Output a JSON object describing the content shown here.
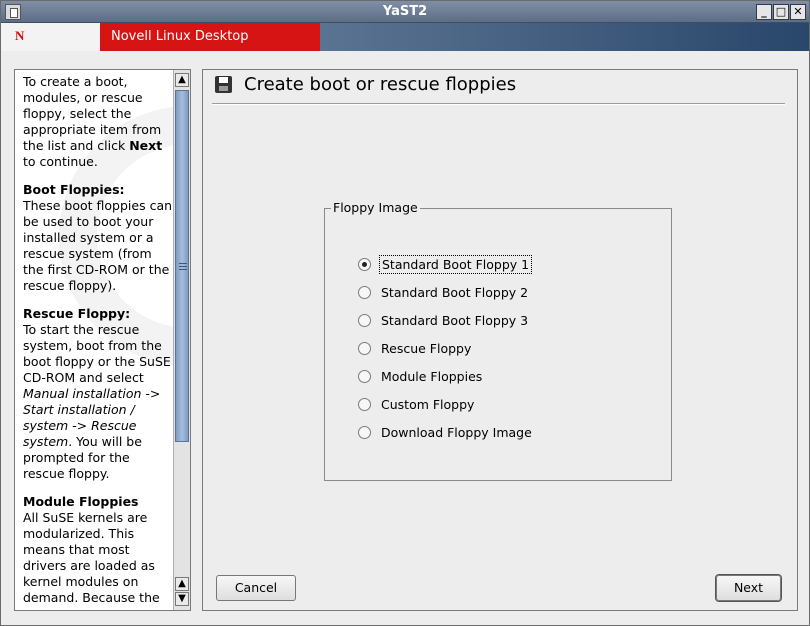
{
  "window": {
    "title": "YaST2",
    "minimize_label": "_",
    "maximize_label": "□",
    "close_label": "✕"
  },
  "banner": {
    "logo": "N",
    "product": "Novell Linux Desktop"
  },
  "help": {
    "intro_1": "To create a boot, modules, or rescue floppy, select the appropriate item from the list and click ",
    "intro_next": "Next",
    "intro_2": " to continue.",
    "boot_title": "Boot Floppies:",
    "boot_text": "These boot floppies can be used to boot your installed system or a rescue system (from the first CD-ROM or the rescue floppy).",
    "rescue_title": "Rescue Floppy:",
    "rescue_text_1": "To start the rescue system, boot from the boot floppy or the SuSE CD-ROM and select ",
    "rescue_italic": "Manual installation -> Start installation / system -> Rescue system",
    "rescue_text_2": ". You will be prompted for the rescue floppy.",
    "module_title": "Module Floppies",
    "module_text": "All SuSE kernels are modularized. This means that most drivers are loaded as kernel modules on demand. Because the space on",
    "scroll_up": "▲",
    "scroll_down": "▼"
  },
  "main": {
    "heading": "Create boot or rescue floppies",
    "group_label": "Floppy Image",
    "options": [
      {
        "label": "Standard Boot Floppy 1",
        "checked": true
      },
      {
        "label": "Standard Boot Floppy 2",
        "checked": false
      },
      {
        "label": "Standard Boot Floppy 3",
        "checked": false
      },
      {
        "label": "Rescue Floppy",
        "checked": false
      },
      {
        "label": "Module Floppies",
        "checked": false
      },
      {
        "label": "Custom Floppy",
        "checked": false
      },
      {
        "label": "Download Floppy Image",
        "checked": false
      }
    ],
    "cancel_label": "Cancel",
    "next_label": "Next"
  }
}
